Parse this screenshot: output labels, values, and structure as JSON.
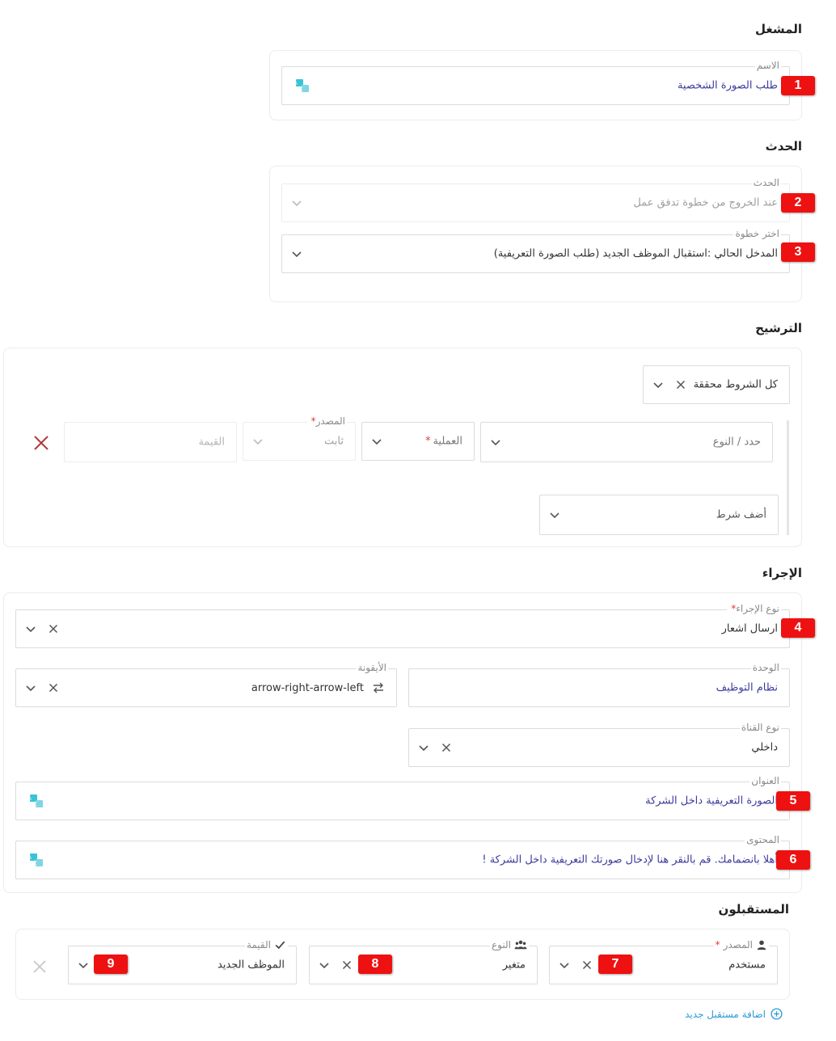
{
  "operator": {
    "title": "المشغل",
    "name_label": "الاسم",
    "name_value": "طلب الصورة الشخصية"
  },
  "event": {
    "title": "الحدث",
    "event_label": "الحدث",
    "event_value": "عند الخروج من خطوة تدفق عمل",
    "step_label": "اختر خطوة",
    "step_value": "المدخل الحالي :استقبال الموظف الجديد (طلب الصورة التعريفية)"
  },
  "filter": {
    "title": "الترشيح",
    "all_conditions": "كل الشروط محققة",
    "type_placeholder": "حدد / النوع",
    "operation_label": "العملية",
    "source_label": "المصدر",
    "source_value": "ثابت",
    "value_placeholder": "القيمة",
    "add_condition": "أضف شرط"
  },
  "action": {
    "title": "الإجراء",
    "action_type_label": "نوع الإجراء",
    "action_type_value": "ارسال اشعار",
    "unit_label": "الوحدة",
    "unit_value": "نظام التوظيف",
    "icon_label": "الأيقونة",
    "icon_value": "arrow-right-arrow-left",
    "channel_label": "نوع القناة",
    "channel_value": "داخلي",
    "subject_label": "العنوان",
    "subject_value": "الصورة التعريفية داخل الشركة",
    "content_label": "المحتوى",
    "content_value": "أهلا بانضمامك. قم بالنقر هنا لإدخال صورتك التعريفية داخل الشركة !"
  },
  "recipients": {
    "title": "المستقبلون",
    "source_label": "المصدر",
    "source_value": "مستخدم",
    "type_label": "النوع",
    "type_value": "متغير",
    "value_label": "القيمة",
    "value_value": "الموظف الجديد",
    "add_recipient": "اضافة مستقبل جديد"
  },
  "badges": [
    "1",
    "2",
    "3",
    "4",
    "5",
    "6",
    "7",
    "8",
    "9"
  ],
  "colors": {
    "badge": "#ee1111",
    "link": "#2b9ad7",
    "value_text": "#3b3b9c",
    "remove_icon": "#b33a3a",
    "required": "#e23a3a"
  }
}
